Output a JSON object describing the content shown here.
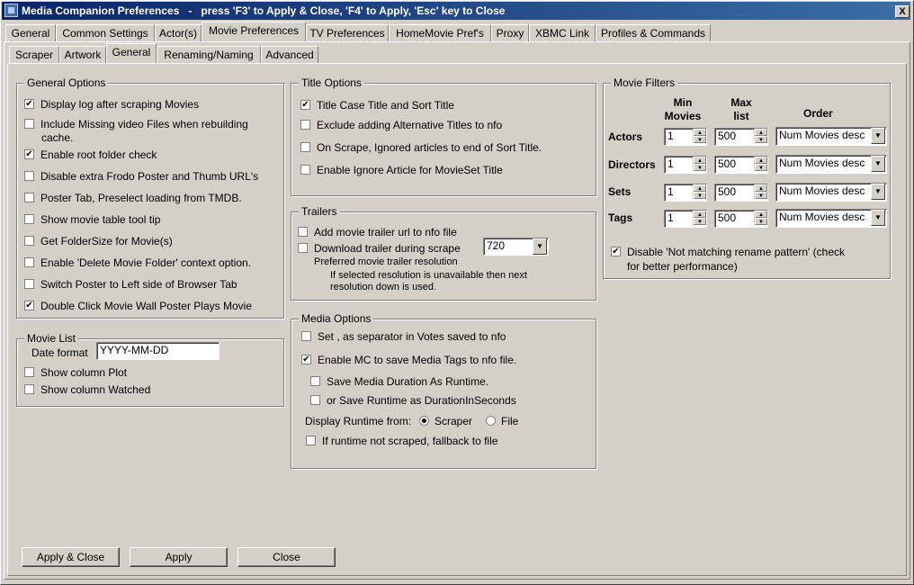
{
  "window": {
    "title": "Media Companion Preferences   -   press 'F3' to Apply & Close, 'F4' to Apply, 'Esc' key to Close",
    "close_label": "X"
  },
  "main_tabs": [
    {
      "label": "General"
    },
    {
      "label": "Common Settings"
    },
    {
      "label": "Actor(s)"
    },
    {
      "label": "Movie Preferences"
    },
    {
      "label": "TV Preferences"
    },
    {
      "label": "HomeMovie Pref's"
    },
    {
      "label": "Proxy"
    },
    {
      "label": "XBMC Link"
    },
    {
      "label": "Profiles & Commands"
    }
  ],
  "sub_tabs": [
    {
      "label": "Scraper"
    },
    {
      "label": "Artwork"
    },
    {
      "label": "General"
    },
    {
      "label": "Renaming/Naming"
    },
    {
      "label": "Advanced"
    }
  ],
  "general_options": {
    "title": "General Options",
    "items": [
      {
        "label": "Display log after scraping Movies",
        "checked": true
      },
      {
        "label": "Include Missing video Files when rebuilding",
        "label2": "cache.",
        "checked": false
      },
      {
        "label": "Enable root folder check",
        "checked": true
      },
      {
        "label": "Disable extra Frodo Poster and Thumb URL's",
        "checked": false
      },
      {
        "label": "Poster Tab, Preselect loading from TMDB.",
        "checked": false
      },
      {
        "label": "Show movie table tool tip",
        "checked": false
      },
      {
        "label": "Get FolderSize for Movie(s)",
        "checked": false
      },
      {
        "label": "Enable 'Delete Movie Folder' context option.",
        "checked": false
      },
      {
        "label": "Switch Poster to Left side of Browser Tab",
        "checked": false
      },
      {
        "label": "Double Click Movie Wall Poster Plays Movie",
        "checked": true
      }
    ]
  },
  "movie_list": {
    "title": "Movie List",
    "date_format_label": "Date format",
    "date_format_value": "YYYY-MM-DD",
    "items": [
      {
        "label": "Show column Plot",
        "checked": false
      },
      {
        "label": "Show column Watched",
        "checked": false
      }
    ]
  },
  "title_options": {
    "title": "Title Options",
    "items": [
      {
        "label": "Title Case Title and Sort Title",
        "checked": true
      },
      {
        "label": "Exclude adding Alternative Titles to nfo",
        "checked": false
      },
      {
        "label": "On Scrape, Ignored articles to end of Sort Title.",
        "checked": false
      },
      {
        "label": "Enable Ignore Article for MovieSet Title",
        "checked": false
      }
    ]
  },
  "trailers": {
    "title": "Trailers",
    "items": [
      {
        "label": "Add movie trailer url to nfo file",
        "checked": false
      },
      {
        "label": "Download trailer during scrape",
        "checked": false
      }
    ],
    "resolution_label": "Preferred movie trailer resolution",
    "resolution_value": "720",
    "note_line1": "If selected resolution is unavailable then next",
    "note_line2": "resolution down is used."
  },
  "media_options": {
    "title": "Media Options",
    "items": [
      {
        "label": "Set , as separator in Votes saved to nfo",
        "checked": false
      },
      {
        "label": "Enable MC to save Media Tags to nfo file.",
        "checked": true
      },
      {
        "label": "Save Media Duration As Runtime.",
        "checked": false
      },
      {
        "label": "or Save Runtime as DurationInSeconds",
        "checked": false
      }
    ],
    "runtime_label": "Display Runtime from:",
    "runtime_options": [
      {
        "label": "Scraper",
        "selected": true
      },
      {
        "label": "File",
        "selected": false
      }
    ],
    "fallback": {
      "label": "If runtime not scraped, fallback to file",
      "checked": false
    }
  },
  "movie_filters": {
    "title": "Movie Filters",
    "col_min_1": "Min",
    "col_min_2": "Movies",
    "col_max_1": "Max",
    "col_max_2": "list",
    "col_order": "Order",
    "rows": [
      {
        "label": "Actors",
        "min": "1",
        "max": "500",
        "order": "Num Movies desc"
      },
      {
        "label": "Directors",
        "min": "1",
        "max": "500",
        "order": "Num Movies desc"
      },
      {
        "label": "Sets",
        "min": "1",
        "max": "500",
        "order": "Num Movies desc"
      },
      {
        "label": "Tags",
        "min": "1",
        "max": "500",
        "order": "Num Movies desc"
      }
    ],
    "disable_rename": {
      "label": "Disable 'Not matching rename pattern' (check",
      "label2": "for better performance)",
      "checked": true
    }
  },
  "buttons": {
    "apply_close": "Apply  &  Close",
    "apply": "Apply",
    "close": "Close"
  },
  "colors": {
    "face": "#d4d0c8",
    "title_start": "#0a246a",
    "title_end": "#3a6ea5"
  }
}
